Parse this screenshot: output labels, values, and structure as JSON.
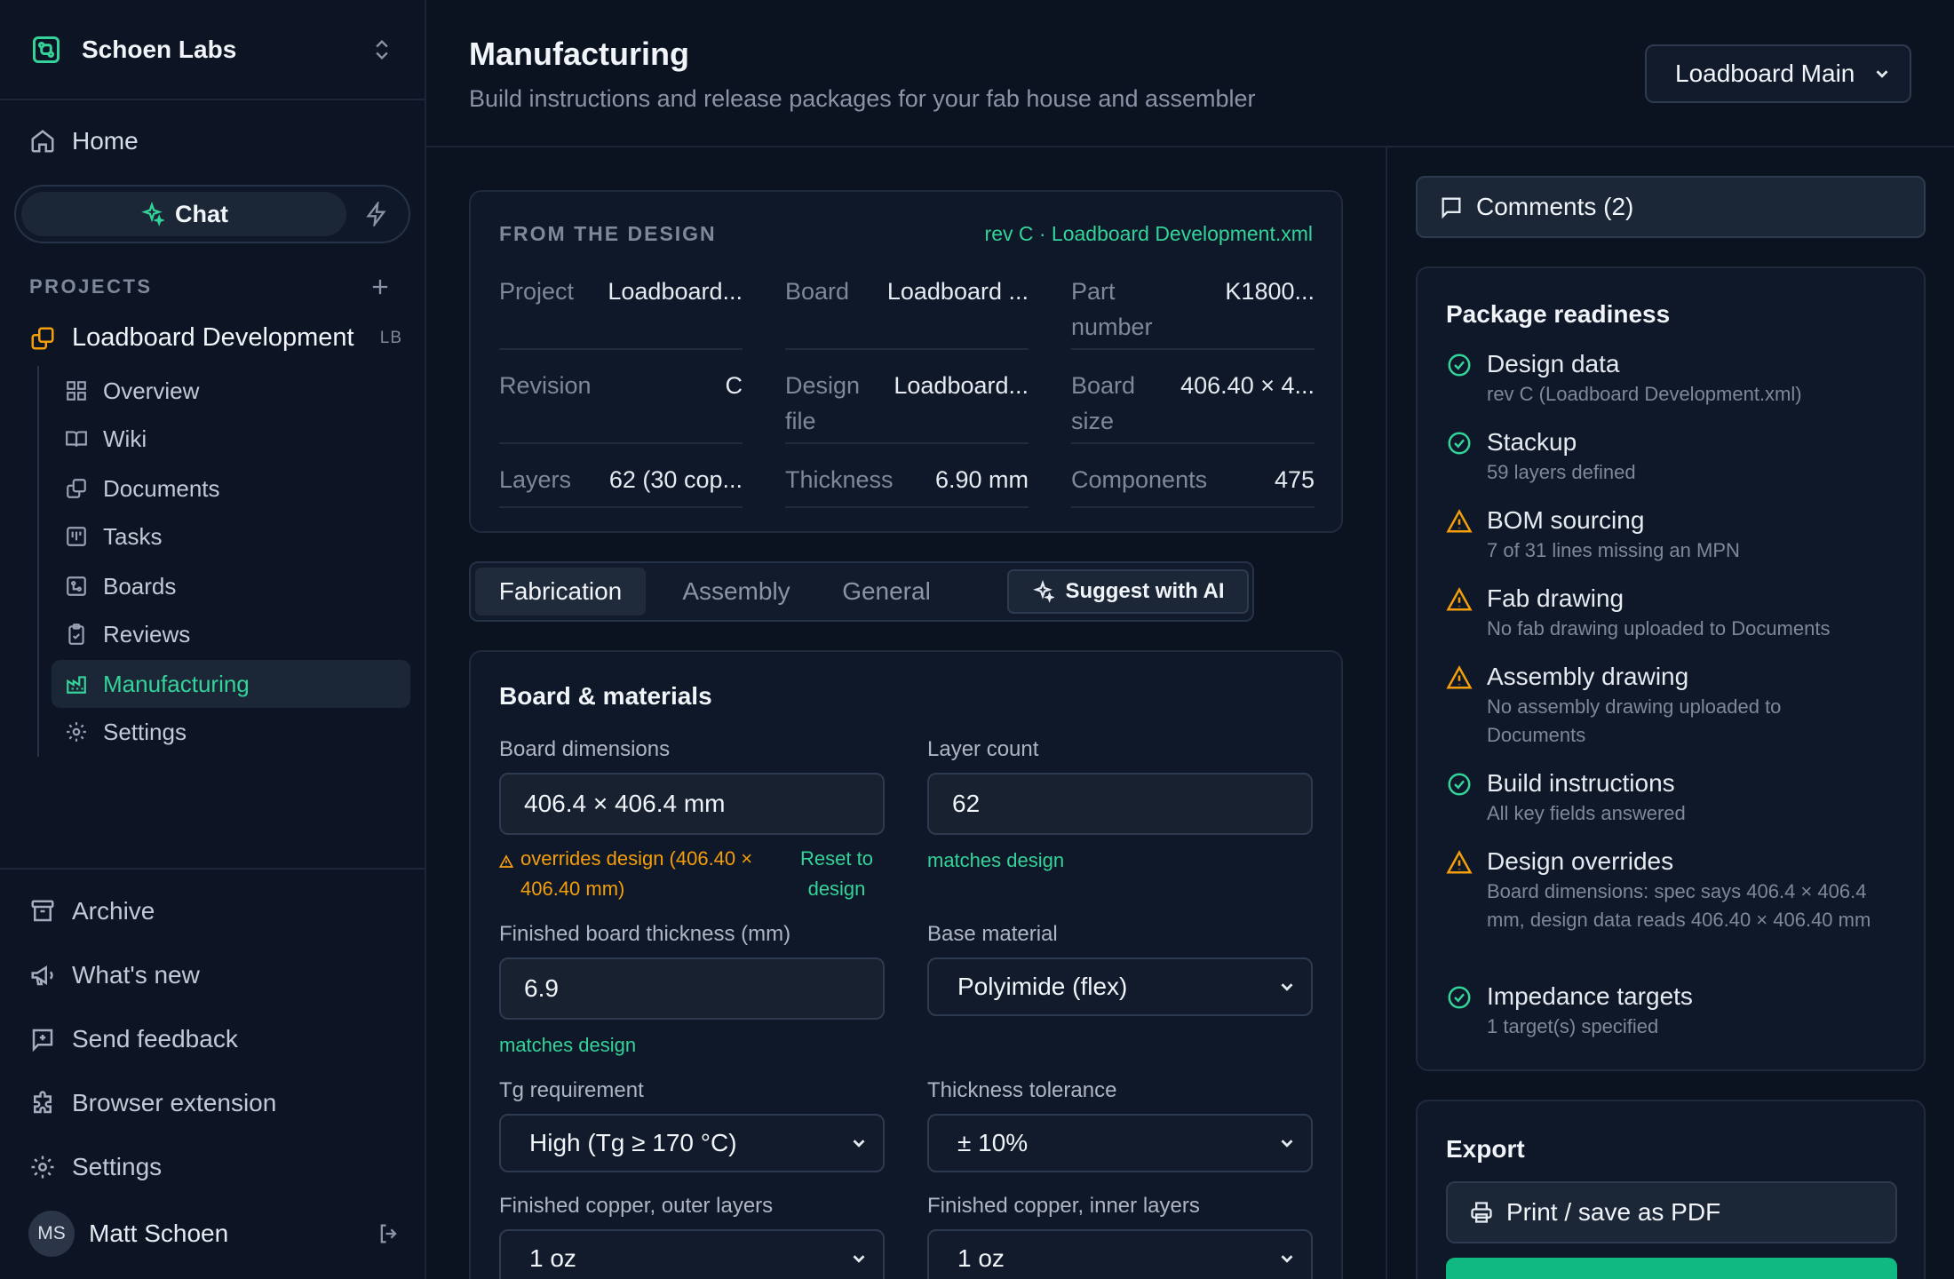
{
  "sidebar": {
    "org_name": "Schoen Labs",
    "home": "Home",
    "chat": "Chat",
    "projects_label": "PROJECTS",
    "project": {
      "name": "Loadboard Development",
      "abbr": "LB"
    },
    "items": [
      {
        "label": "Overview",
        "icon": "overview-icon"
      },
      {
        "label": "Wiki",
        "icon": "book-icon"
      },
      {
        "label": "Documents",
        "icon": "documents-icon"
      },
      {
        "label": "Tasks",
        "icon": "tasks-icon"
      },
      {
        "label": "Boards",
        "icon": "board-icon"
      },
      {
        "label": "Reviews",
        "icon": "clipboard-check-icon"
      },
      {
        "label": "Manufacturing",
        "icon": "factory-icon",
        "active": true
      },
      {
        "label": "Settings",
        "icon": "gear-icon"
      }
    ],
    "bottom": {
      "archive": "Archive",
      "whats_new": "What's new",
      "feedback": "Send feedback",
      "extension": "Browser extension",
      "settings": "Settings"
    },
    "user": {
      "initials": "MS",
      "name": "Matt Schoen"
    }
  },
  "header": {
    "title": "Manufacturing",
    "subtitle": "Build instructions and release packages for your fab house and assembler",
    "board_select": "Loadboard Main"
  },
  "design": {
    "heading": "FROM THE DESIGN",
    "revision_link": "rev C · Loadboard Development.xml",
    "fields": {
      "project": {
        "k": "Project",
        "v": "Loadboard..."
      },
      "board": {
        "k": "Board",
        "v": "Loadboard ..."
      },
      "part": {
        "k": "Part number",
        "v": "K1800..."
      },
      "revision": {
        "k": "Revision",
        "v": "C"
      },
      "design_file": {
        "k": "Design file",
        "v": "Loadboard..."
      },
      "board_size": {
        "k": "Board size",
        "v": "406.40 × 4..."
      },
      "layers": {
        "k": "Layers",
        "v": "62 (30 cop..."
      },
      "thickness": {
        "k": "Thickness",
        "v": "6.90 mm"
      },
      "components": {
        "k": "Components",
        "v": "475"
      }
    }
  },
  "tabs": {
    "fabrication": "Fabrication",
    "assembly": "Assembly",
    "general": "General",
    "suggest": "Suggest with AI"
  },
  "form": {
    "title": "Board & materials",
    "board_dimensions": {
      "label": "Board dimensions",
      "value": "406.4 × 406.4 mm",
      "warning": "overrides design (406.40 × 406.40 mm)",
      "reset": "Reset to design"
    },
    "layer_count": {
      "label": "Layer count",
      "value": "62",
      "hint": "matches design"
    },
    "thickness": {
      "label": "Finished board thickness (mm)",
      "value": "6.9",
      "hint": "matches design"
    },
    "base_material": {
      "label": "Base material",
      "value": "Polyimide (flex)"
    },
    "tg": {
      "label": "Tg requirement",
      "value": "High (Tg ≥ 170 °C)"
    },
    "thickness_tolerance": {
      "label": "Thickness tolerance",
      "value": "± 10%"
    },
    "copper_outer": {
      "label": "Finished copper, outer layers",
      "value": "1 oz"
    },
    "copper_inner": {
      "label": "Finished copper, inner layers",
      "value": "1 oz"
    }
  },
  "right": {
    "comments": "Comments (2)",
    "readiness_title": "Package readiness",
    "readiness": [
      {
        "title": "Design data",
        "desc": "rev C (Loadboard Development.xml)",
        "status": "ok"
      },
      {
        "title": "Stackup",
        "desc": "59 layers defined",
        "status": "ok"
      },
      {
        "title": "BOM sourcing",
        "desc": "7 of 31 lines missing an MPN",
        "status": "warn"
      },
      {
        "title": "Fab drawing",
        "desc": "No fab drawing uploaded to Documents",
        "status": "warn"
      },
      {
        "title": "Assembly drawing",
        "desc": "No assembly drawing uploaded to Documents",
        "status": "warn"
      },
      {
        "title": "Build instructions",
        "desc": "All key fields answered",
        "status": "ok"
      },
      {
        "title": "Design overrides",
        "desc": "Board dimensions: spec says 406.4 × 406.4 mm, design data reads 406.40 × 406.40 mm",
        "status": "warn"
      },
      {
        "title": "Impedance targets",
        "desc": "1 target(s) specified",
        "status": "ok"
      }
    ],
    "export_title": "Export",
    "print_pdf": "Print / save as PDF"
  },
  "colors": {
    "accent": "#34d399",
    "warning": "#f59e0b",
    "background": "#0b1220",
    "panel": "#0f1828"
  }
}
